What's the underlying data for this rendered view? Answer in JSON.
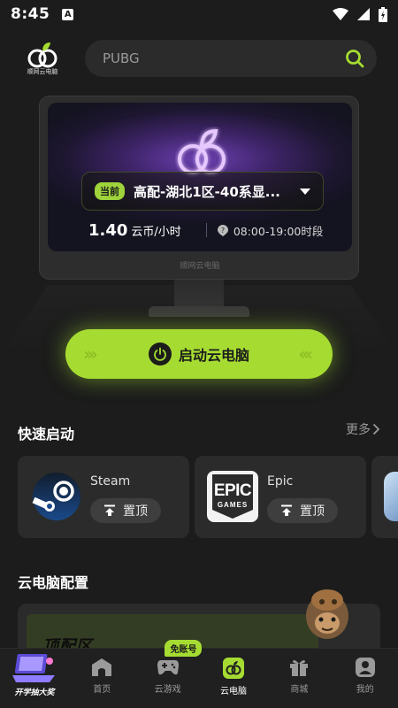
{
  "status_bar": {
    "time": "8:45",
    "notif_letter": "A"
  },
  "header": {
    "logo_text": "顺网云电脑",
    "search": {
      "placeholder": "PUBG"
    }
  },
  "monitor": {
    "badge": "当前",
    "config_name": "高配-湖北1区-40系显...",
    "price_value": "1.40",
    "price_unit": "云币/小时",
    "time_slot": "08:00-19:00时段",
    "brand": "顺网云电脑"
  },
  "start_button": {
    "label": "启动云电脑"
  },
  "quick_launch": {
    "title": "快速启动",
    "more": "更多",
    "apps": [
      {
        "name": "Steam",
        "pin_label": "置顶"
      },
      {
        "name": "Epic",
        "pin_label": "置顶",
        "icon_text_top": "EPIC",
        "icon_text_bottom": "GAMES"
      }
    ]
  },
  "cloud_config": {
    "title": "云电脑配置",
    "banner_text": "顶配区"
  },
  "tabbar": {
    "promo_label": "开学抽大奖",
    "tabs": [
      {
        "label": "首页",
        "icon": "home-icon"
      },
      {
        "label": "云游戏",
        "icon": "gamepad-icon",
        "badge": "免账号"
      },
      {
        "label": "云电脑",
        "icon": "cloud-pc-icon",
        "active": true
      },
      {
        "label": "商城",
        "icon": "gift-icon"
      },
      {
        "label": "我的",
        "icon": "user-icon"
      }
    ]
  },
  "colors": {
    "accent": "#a6dc32",
    "background": "#1b1c1b",
    "card": "#2a2b2a"
  }
}
